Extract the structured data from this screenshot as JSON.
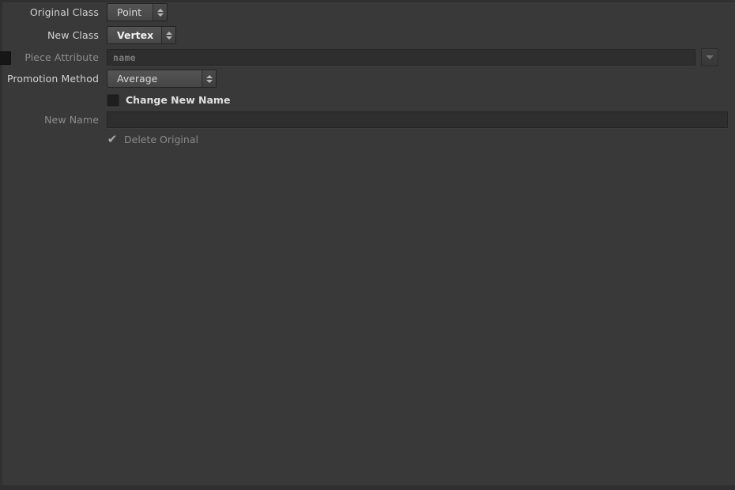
{
  "panel": {
    "background_color": "#393939",
    "edge_color": "#303030"
  },
  "form": {
    "rows": [
      {
        "label": "Original Class",
        "type": "combo",
        "value": "Point",
        "enabled": true,
        "emphasized": false
      },
      {
        "label": "New Class",
        "type": "combo",
        "value": "Vertex",
        "enabled": true,
        "emphasized": true
      },
      {
        "label": "Piece Attribute",
        "type": "text",
        "value": "",
        "placeholder": "name",
        "enabled": false,
        "has_dropdown_button": true
      },
      {
        "label": "Promotion Method",
        "type": "combo",
        "value": "Average",
        "enabled": true,
        "emphasized": false
      },
      {
        "label": "",
        "type": "checkbox",
        "value": "Change New Name",
        "checked": false,
        "enabled": true
      },
      {
        "label": "New Name",
        "type": "text",
        "value": "",
        "placeholder": "",
        "enabled": false,
        "has_dropdown_button": false
      },
      {
        "label": "",
        "type": "checkbox",
        "value": "Delete Original",
        "checked": true,
        "enabled": false
      }
    ]
  },
  "icons": {
    "spinner_up": "triangle-up-icon",
    "spinner_down": "triangle-down-icon",
    "dropdown": "chevron-down-icon",
    "check": "✔"
  },
  "labels": {
    "original_class": "Original Class",
    "new_class": "New Class",
    "piece_attribute": "Piece Attribute",
    "promotion_method": "Promotion Method",
    "new_name": "New Name",
    "change_new_name": "Change New Name",
    "delete_original": "Delete Original"
  },
  "values": {
    "original_class": "Point",
    "new_class": "Vertex",
    "piece_attribute_placeholder": "name",
    "promotion_method": "Average",
    "new_name": ""
  },
  "checkmark_glyph": "✔"
}
